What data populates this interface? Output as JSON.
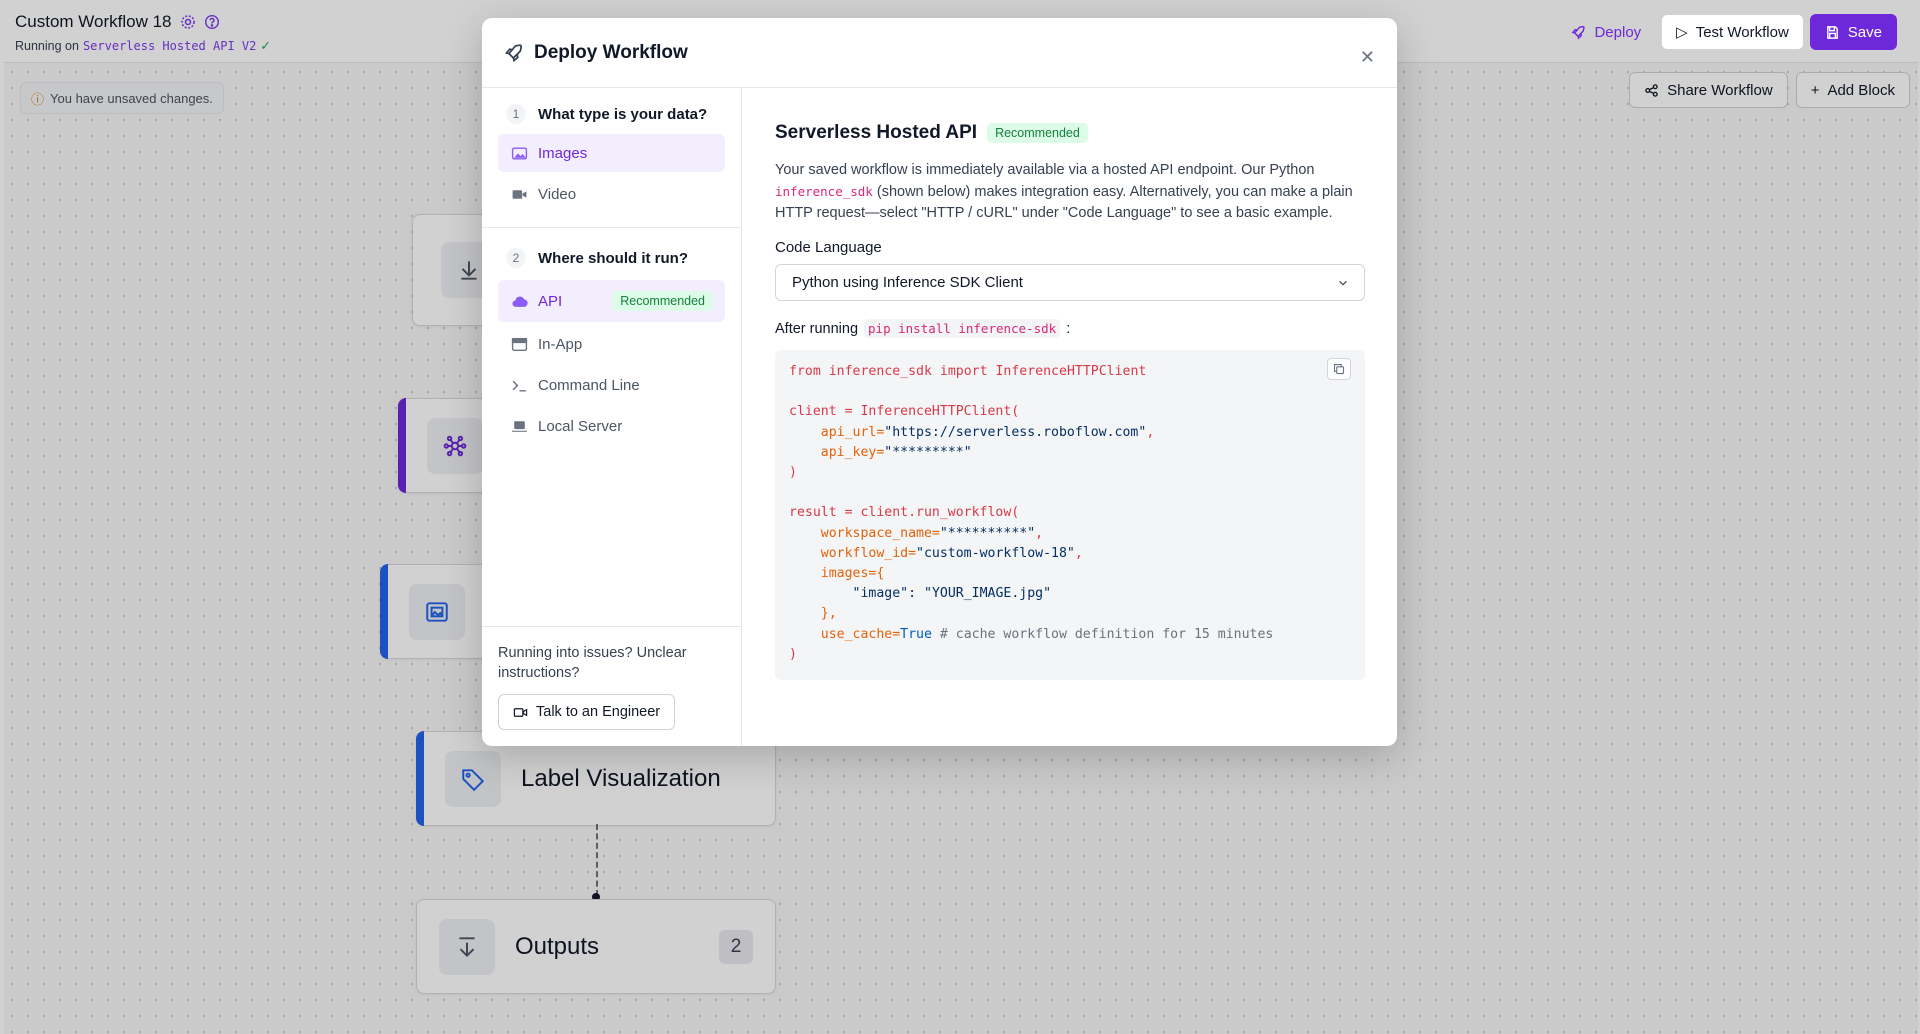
{
  "header": {
    "workflow_title": "Custom Workflow 18",
    "running_on_label": "Running on",
    "running_on_target": "Serverless Hosted API V2",
    "deploy_label": "Deploy",
    "test_label": "Test Workflow",
    "save_label": "Save"
  },
  "canvas": {
    "unsaved_notice": "You have unsaved changes.",
    "share_label": "Share Workflow",
    "add_block_label": "Add Block",
    "nodes": {
      "label_visualization": "Label Visualization",
      "outputs": "Outputs",
      "outputs_count": "2"
    },
    "accent_colors": {
      "purple": "#6d28d9",
      "blue": "#2563eb"
    }
  },
  "modal": {
    "title": "Deploy Workflow",
    "close_icon": "close-icon",
    "step1": {
      "number": "1",
      "question": "What type is your data?"
    },
    "data_types": [
      "Images",
      "Video"
    ],
    "step2": {
      "number": "2",
      "question": "Where should it run?"
    },
    "run_options": [
      "API",
      "In-App",
      "Command Line",
      "Local Server"
    ],
    "api_badge": "Recommended",
    "help_text": "Running into issues? Unclear instructions?",
    "talk_label": "Talk to an Engineer",
    "content": {
      "heading": "Serverless Hosted API",
      "heading_badge": "Recommended",
      "desc_part1": "Your saved workflow is immediately available via a hosted API endpoint. Our Python",
      "desc_code": "inference_sdk",
      "desc_part2": "(shown below) makes integration easy. Alternatively, you can make a plain HTTP request—select \"HTTP / cURL\" under \"Code Language\" to see a basic example.",
      "code_language_label": "Code Language",
      "code_language_value": "Python using Inference SDK Client",
      "after_running_label": "After running",
      "install_command": "pip install inference-sdk",
      "after_running_suffix": ":",
      "code": {
        "import_from": "from",
        "import_module": "inference_sdk",
        "import_kw": "import",
        "import_name": "InferenceHTTPClient",
        "client_line": "client = InferenceHTTPClient(",
        "api_url_key": "api_url=",
        "api_url_val": "\"https://serverless.roboflow.com\"",
        "api_key_key": "api_key=",
        "api_key_val": "\"*********\"",
        "close1": ")",
        "result_line": "result = client.run_workflow(",
        "ws_key": "workspace_name=",
        "ws_val": "\"**********\"",
        "wf_key": "workflow_id=",
        "wf_val": "\"custom-workflow-18\"",
        "images_key": "images={",
        "image_entry_key": "\"image\"",
        "image_entry_val": "\"YOUR_IMAGE.jpg\"",
        "images_close": "},",
        "cache_key": "use_cache=",
        "cache_val": "True",
        "cache_comment": "# cache workflow definition for 15 minutes",
        "close2": ")"
      }
    }
  }
}
